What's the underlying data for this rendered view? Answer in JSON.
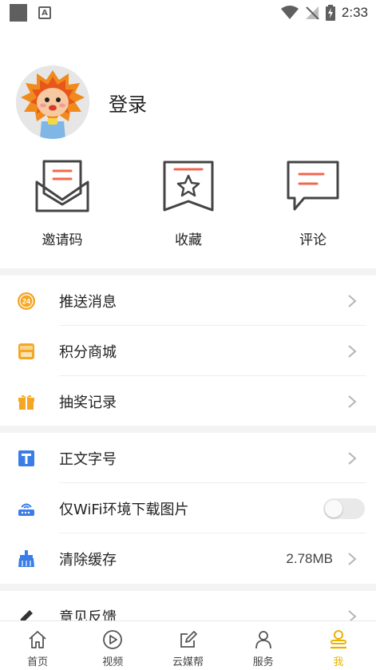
{
  "status_bar": {
    "time": "2:33"
  },
  "profile": {
    "login_label": "登录"
  },
  "shortcuts": [
    {
      "label": "邀请码",
      "icon": "invite-envelope-icon"
    },
    {
      "label": "收藏",
      "icon": "bookmark-star-icon"
    },
    {
      "label": "评论",
      "icon": "comment-bubble-icon"
    }
  ],
  "group1": [
    {
      "label": "推送消息",
      "icon": "push-24-icon"
    },
    {
      "label": "积分商城",
      "icon": "points-shop-icon"
    },
    {
      "label": "抽奖记录",
      "icon": "gift-icon"
    }
  ],
  "group2": [
    {
      "label": "正文字号",
      "icon": "font-size-icon"
    },
    {
      "label": "仅WiFi环境下载图片",
      "icon": "wifi-router-icon",
      "toggle_on": false
    },
    {
      "label": "清除缓存",
      "icon": "broom-icon",
      "value": "2.78MB"
    }
  ],
  "group3": [
    {
      "label": "意见反馈",
      "icon": "pencil-icon"
    }
  ],
  "tabs": [
    {
      "label": "首页",
      "icon": "home-icon"
    },
    {
      "label": "视频",
      "icon": "play-circle-icon"
    },
    {
      "label": "云媒帮",
      "icon": "edit-square-icon"
    },
    {
      "label": "服务",
      "icon": "person-icon"
    },
    {
      "label": "我",
      "icon": "me-icon",
      "active": true
    }
  ],
  "colors": {
    "accent": "#e8b400",
    "icon_red": "#f0674f",
    "icon_orange": "#f5a623",
    "icon_blue": "#3b7de8"
  }
}
